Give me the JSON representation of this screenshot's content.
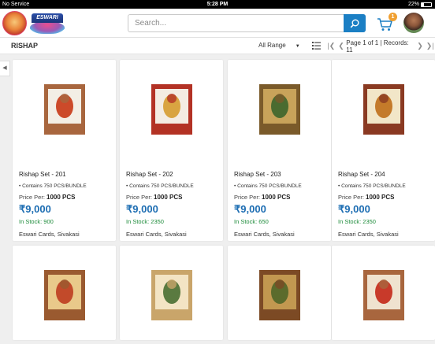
{
  "status_bar": {
    "carrier": "No Service",
    "time": "5:28 PM",
    "battery": "22%",
    "battery_level": 0.22
  },
  "header": {
    "logo_brand": "ESWARI",
    "search_placeholder": "Search...",
    "cart_count": "1"
  },
  "toolbar": {
    "title": "RISHAP",
    "range_selected": "All Range",
    "pager_text": "Page 1 of 1 | Records: 11"
  },
  "products": [
    {
      "name": "Rishap Set - 201",
      "contains": "• Contains 750 PCS/BUNDLE",
      "price_per_label": "Price Per:",
      "price_per_qty": "1000 PCS",
      "price": "₹9,000",
      "stock_label": "In Stock:",
      "stock": "900",
      "seller": "Eswari Cards, Sivakasi",
      "colors": [
        "#a8663e",
        "#f3eee5",
        "#cc4a2a"
      ]
    },
    {
      "name": "Rishap Set - 202",
      "contains": "• Contains 750 PCS/BUNDLE",
      "price_per_label": "Price Per:",
      "price_per_qty": "1000 PCS",
      "price": "₹9,000",
      "stock_label": "In Stock:",
      "stock": "2350",
      "seller": "Eswari Cards, Sivakasi",
      "colors": [
        "#b33225",
        "#f4ece3",
        "#d9a441"
      ]
    },
    {
      "name": "Rishap Set - 203",
      "contains": "• Contains 750 PCS/BUNDLE",
      "price_per_label": "Price Per:",
      "price_per_qty": "1000 PCS",
      "price": "₹9,000",
      "stock_label": "In Stock:",
      "stock": "650",
      "seller": "Eswari Cards, Sivakasi",
      "colors": [
        "#7a5a2a",
        "#c8a35a",
        "#4a6b30"
      ]
    },
    {
      "name": "Rishap Set - 204",
      "contains": "• Contains 750 PCS/BUNDLE",
      "price_per_label": "Price Per:",
      "price_per_qty": "1000 PCS",
      "price": "₹9,000",
      "stock_label": "In Stock:",
      "stock": "2350",
      "seller": "Eswari Cards, Sivakasi",
      "colors": [
        "#8a3a22",
        "#f2e6c8",
        "#c47a2a"
      ]
    },
    {
      "colors": [
        "#9a5a30",
        "#e9c98a",
        "#c24a2a"
      ]
    },
    {
      "colors": [
        "#c9a56a",
        "#f3e4c4",
        "#5a7a40"
      ]
    },
    {
      "colors": [
        "#7c4a25",
        "#c29850",
        "#5b6b2c"
      ]
    },
    {
      "colors": [
        "#a8663e",
        "#efe2cf",
        "#c83a2a"
      ]
    }
  ]
}
